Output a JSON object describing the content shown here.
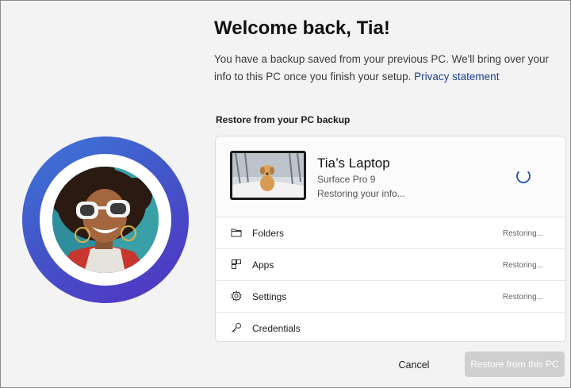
{
  "header": {
    "title": "Welcome back, Tia!",
    "description": "You have a backup saved from your previous PC. We'll bring over your info to this PC once you finish your setup.",
    "privacy_link": "Privacy statement"
  },
  "restore": {
    "section_label": "Restore from your PC backup",
    "device": {
      "name": "Tia’s Laptop",
      "model": "Surface Pro 9",
      "status": "Restoring your info..."
    },
    "items": [
      {
        "label": "Folders",
        "status": "Restoring...",
        "icon": "folder-icon"
      },
      {
        "label": "Apps",
        "status": "Restoring...",
        "icon": "apps-icon"
      },
      {
        "label": "Settings",
        "status": "Restoring...",
        "icon": "gear-icon"
      },
      {
        "label": "Credentials",
        "status": "",
        "icon": "key-icon"
      }
    ]
  },
  "footer": {
    "cancel_label": "Cancel",
    "restore_label": "Restore from this PC"
  },
  "colors": {
    "background": "#f3f3f3",
    "accent_link": "#1b3f8c",
    "ring_gradient_start": "#3f78d8",
    "ring_gradient_end": "#5232c2",
    "disabled_button": "#cfcfcf"
  }
}
